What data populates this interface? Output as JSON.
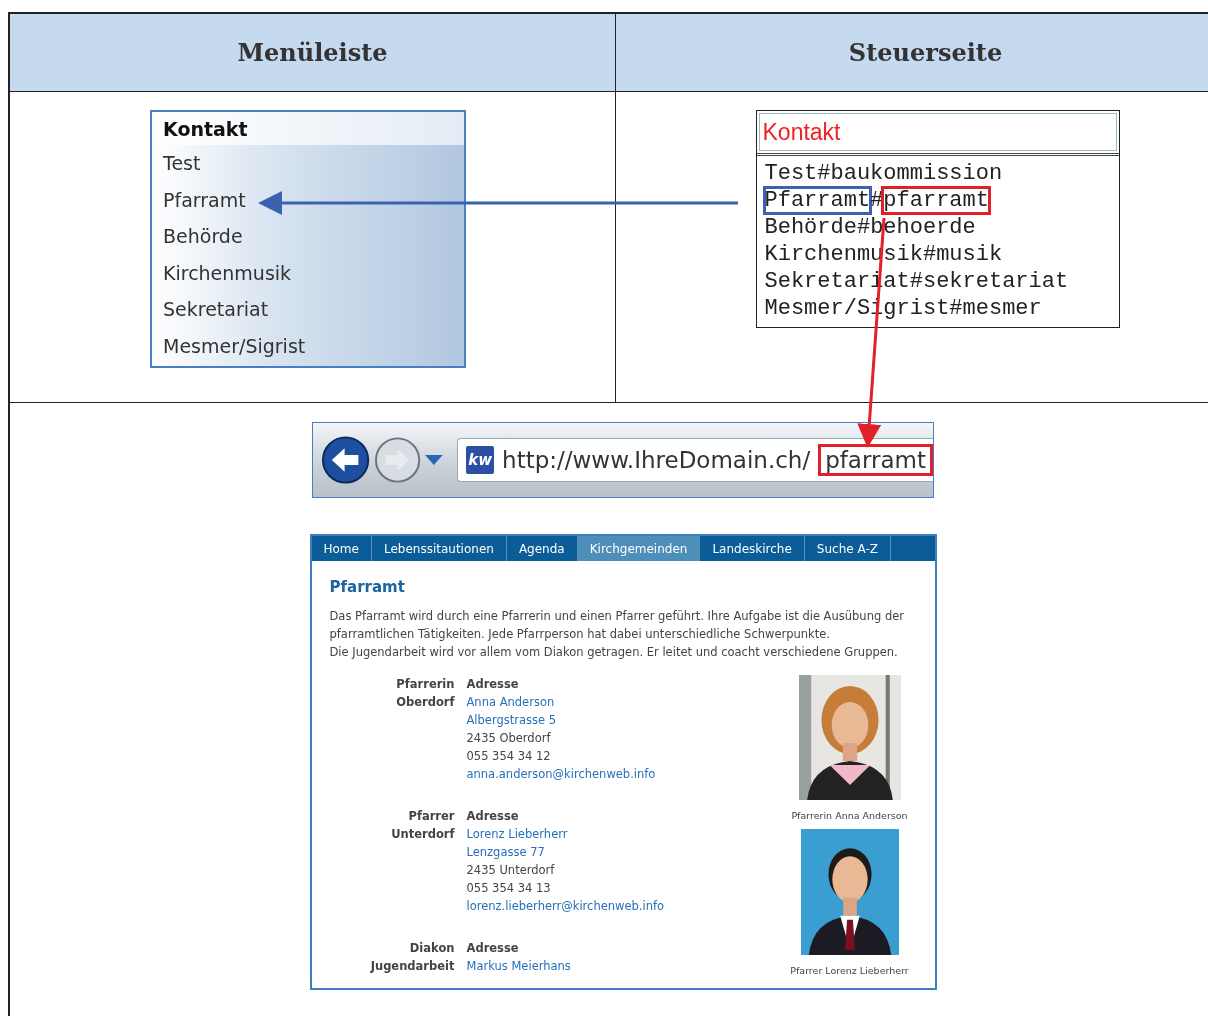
{
  "table": {
    "headers": [
      "Menüleiste",
      "Steuerseite"
    ]
  },
  "menu": {
    "title": "Kontakt",
    "items": [
      {
        "label": "Test"
      },
      {
        "label": "Pfarramt"
      },
      {
        "label": "Behörde"
      },
      {
        "label": "Kirchenmusik"
      },
      {
        "label": "Sekretariat"
      },
      {
        "label": "Mesmer/Sigrist"
      }
    ]
  },
  "control_page": {
    "title": "Kontakt",
    "lines": [
      {
        "title": "Test",
        "separator": "#",
        "slug": "baukommission",
        "highlighted": false
      },
      {
        "title": "Pfarramt",
        "separator": "#",
        "slug": "pfarramt",
        "highlighted": true
      },
      {
        "title": "Behörde",
        "separator": "#",
        "slug": "behoerde",
        "highlighted": false
      },
      {
        "title": "Kirchenmusik",
        "separator": "#",
        "slug": "musik",
        "highlighted": false
      },
      {
        "title": "Sekretariat",
        "separator": "#",
        "slug": "sekretariat",
        "highlighted": false
      },
      {
        "title": "Mesmer/Sigrist",
        "separator": "#",
        "slug": "mesmer",
        "highlighted": false
      }
    ]
  },
  "browser": {
    "url_base": "http://www.IhreDomain.ch/",
    "url_path": "pfarramt",
    "favicon": "kw"
  },
  "website": {
    "nav": [
      {
        "label": "Home",
        "selected": false
      },
      {
        "label": "Lebenssitautionen",
        "selected": false
      },
      {
        "label": "Agenda",
        "selected": false
      },
      {
        "label": "Kirchgemeinden",
        "selected": true
      },
      {
        "label": "Landeskirche",
        "selected": false
      },
      {
        "label": "Suche A-Z",
        "selected": false
      }
    ],
    "heading": "Pfarramt",
    "intro": [
      "Das Pfarramt wird durch eine Pfarrerin und einen Pfarrer geführt. Ihre Aufgabe ist die Ausübung der pfarramtlichen Tätigkeiten. Jede Pfarrperson hat dabei unterschiedliche Schwerpunkte.",
      "Die Jugendarbeit wird vor allem vom Diakon getragen. Er leitet und coacht verschiedene Gruppen."
    ],
    "contacts": [
      {
        "role": [
          "Pfarrerin",
          "Oberdorf"
        ],
        "address_label": "Adresse",
        "name": "Anna Anderson",
        "street": "Albergstrasse 5",
        "city": "2435 Oberdorf",
        "phone": "055 354 34 12",
        "email": "anna.anderson@kirchenweb.info",
        "photo_caption": "Pfarrerin Anna Anderson"
      },
      {
        "role": [
          "Pfarrer",
          "Unterdorf"
        ],
        "address_label": "Adresse",
        "name": "Lorenz Lieberherr",
        "street": "Lenzgasse 77",
        "city": "2435 Unterdorf",
        "phone": "055 354 34 13",
        "email": "lorenz.lieberherr@kirchenweb.info",
        "photo_caption": "Pfarrer Lorenz Lieberherr"
      },
      {
        "role": [
          "Diakon",
          "Jugendarbeit"
        ],
        "address_label": "Adresse",
        "name": "Markus Meierhans"
      }
    ]
  }
}
